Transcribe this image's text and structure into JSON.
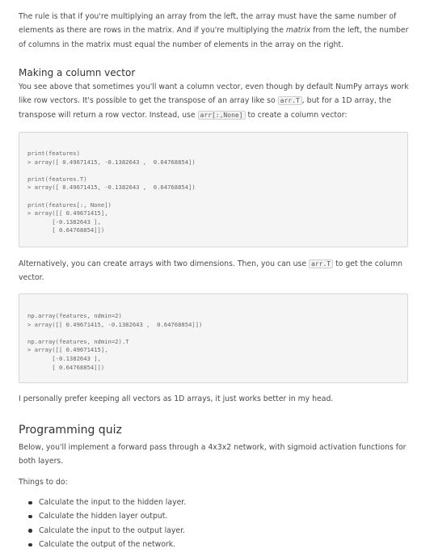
{
  "intro": {
    "line1": "The rule is that if you're multiplying an array from the left, the array must have the same number of",
    "line2_pre": "elements as there are rows in the matrix. And if you're multiplying the ",
    "line2_em": "matrix",
    "line2_post": " from the left, the number",
    "line3": "of columns in the matrix must equal the number of elements in the array on the right."
  },
  "column_vector": {
    "heading": "Making a column vector",
    "line1": "You see above that sometimes you'll want a column vector, even though by default NumPy arrays work",
    "line2_pre": "like row vectors. It's possible to get the transpose of an array like so ",
    "line2_code": "arr.T",
    "line2_post": ", but for a 1D array, the",
    "line3_pre": "transpose will return a row vector. Instead, use ",
    "line3_code": "arr[:,None]",
    "line3_post": " to create a column vector:"
  },
  "code_block_1": [
    "print(features)",
    "> array([ 0.49671415, -0.1382643 ,  0.64768854])",
    "",
    "print(features.T)",
    "> array([ 0.49671415, -0.1382643 ,  0.64768854])",
    "",
    "print(features[:, None])",
    "> array([[ 0.49671415],",
    "       [-0.1382643 ],",
    "       [ 0.64768854]])"
  ],
  "alternative": {
    "line1_pre": "Alternatively, you can create arrays with two dimensions. Then, you can use ",
    "line1_code": "arr.T",
    "line1_post": " to get the column",
    "line2": "vector."
  },
  "code_block_2": [
    "np.array(features, ndmin=2)",
    "> array([[ 0.49671415, -0.1382643 ,  0.64768854]])",
    "",
    "np.array(features, ndmin=2).T",
    "> array([[ 0.49671415],",
    "       [-0.1382643 ],",
    "       [ 0.64768854]])"
  ],
  "preference": "I personally prefer keeping all vectors as 1D arrays, it just works better in my head.",
  "quiz": {
    "heading": "Programming quiz",
    "line1": "Below, you'll implement a forward pass through a 4x3x2 network, with sigmoid activation functions for",
    "line2": "both layers.",
    "todo_label": "Things to do:",
    "items": [
      "Calculate the input to the hidden layer.",
      "Calculate the hidden layer output.",
      "Calculate the input to the output layer.",
      "Calculate the output of the network."
    ]
  }
}
